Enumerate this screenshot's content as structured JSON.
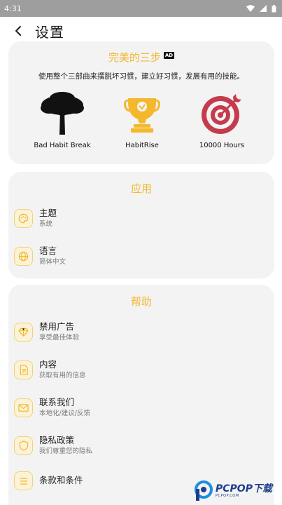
{
  "status_bar": {
    "time": "4:31"
  },
  "header": {
    "title": "设置"
  },
  "ad_card": {
    "title": "完美的三步",
    "badge": "AD",
    "description": "使用整个三部曲来摆脱坏习惯，建立好习惯，发展有用的技能。",
    "apps": [
      {
        "name": "Bad Habit Break"
      },
      {
        "name": "HabitRise"
      },
      {
        "name": "10000 Hours"
      }
    ]
  },
  "app_section": {
    "title": "应用",
    "items": [
      {
        "title": "主题",
        "subtitle": "系统",
        "icon": "palette-icon"
      },
      {
        "title": "语言",
        "subtitle": "简体中文",
        "icon": "globe-icon"
      }
    ]
  },
  "help_section": {
    "title": "帮助",
    "items": [
      {
        "title": "禁用广告",
        "subtitle": "享受最佳体验",
        "icon": "diamond-icon"
      },
      {
        "title": "内容",
        "subtitle": "获取有用的信息",
        "icon": "document-icon"
      },
      {
        "title": "联系我们",
        "subtitle": "本地化/建议/反馈",
        "icon": "mail-icon"
      },
      {
        "title": "隐私政策",
        "subtitle": "我们尊重您的隐私",
        "icon": "shield-icon"
      },
      {
        "title": "条款和条件",
        "subtitle": "",
        "icon": "list-icon"
      }
    ]
  },
  "watermark": {
    "text": "PCPOP下载",
    "sub": "PCPOP.COM"
  },
  "colors": {
    "accent": "#f3b82c",
    "card_bg": "#f3f3f3",
    "icon_border": "#f0d27a",
    "statusbar": "#9e9e9e"
  }
}
